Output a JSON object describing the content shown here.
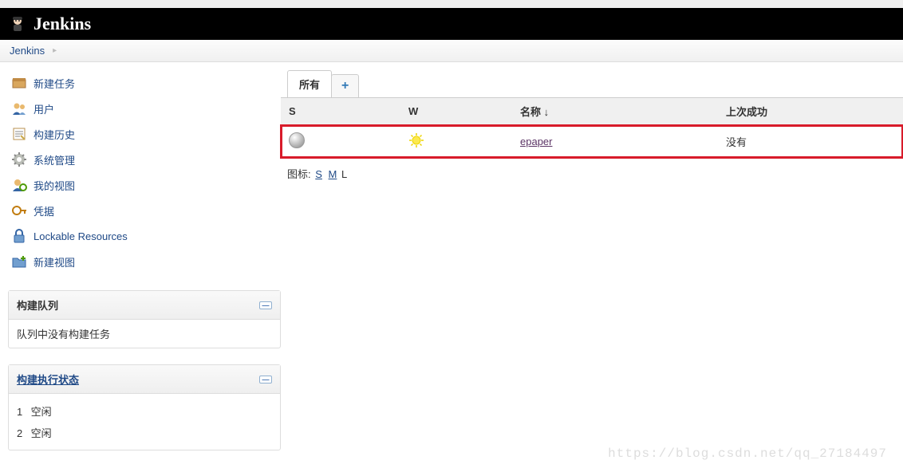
{
  "header": {
    "product_name": "Jenkins"
  },
  "breadcrumb": {
    "root": "Jenkins"
  },
  "sidebar": {
    "tasks": [
      {
        "label": "新建任务",
        "icon": "new-item"
      },
      {
        "label": "用户",
        "icon": "people"
      },
      {
        "label": "构建历史",
        "icon": "build-history"
      },
      {
        "label": "系统管理",
        "icon": "manage"
      },
      {
        "label": "我的视图",
        "icon": "my-views"
      },
      {
        "label": "凭据",
        "icon": "credentials"
      },
      {
        "label": "Lockable Resources",
        "icon": "lock"
      },
      {
        "label": "新建视图",
        "icon": "new-view"
      }
    ],
    "build_queue": {
      "title": "构建队列",
      "empty_text": "队列中没有构建任务"
    },
    "executors": {
      "title": "构建执行状态",
      "rows": [
        {
          "num": "1",
          "status": "空闲"
        },
        {
          "num": "2",
          "status": "空闲"
        }
      ]
    }
  },
  "dashboard": {
    "tabs": {
      "all_label": "所有",
      "add_label": "+"
    },
    "columns": {
      "status": "S",
      "weather": "W",
      "name": "名称 ↓",
      "last_success": "上次成功"
    },
    "rows": [
      {
        "name": "epaper",
        "last_success": "没有"
      }
    ],
    "icon_legend": {
      "label": "图标:",
      "s": "S",
      "m": "M",
      "l": "L"
    }
  },
  "watermark": "https://blog.csdn.net/qq_27184497"
}
